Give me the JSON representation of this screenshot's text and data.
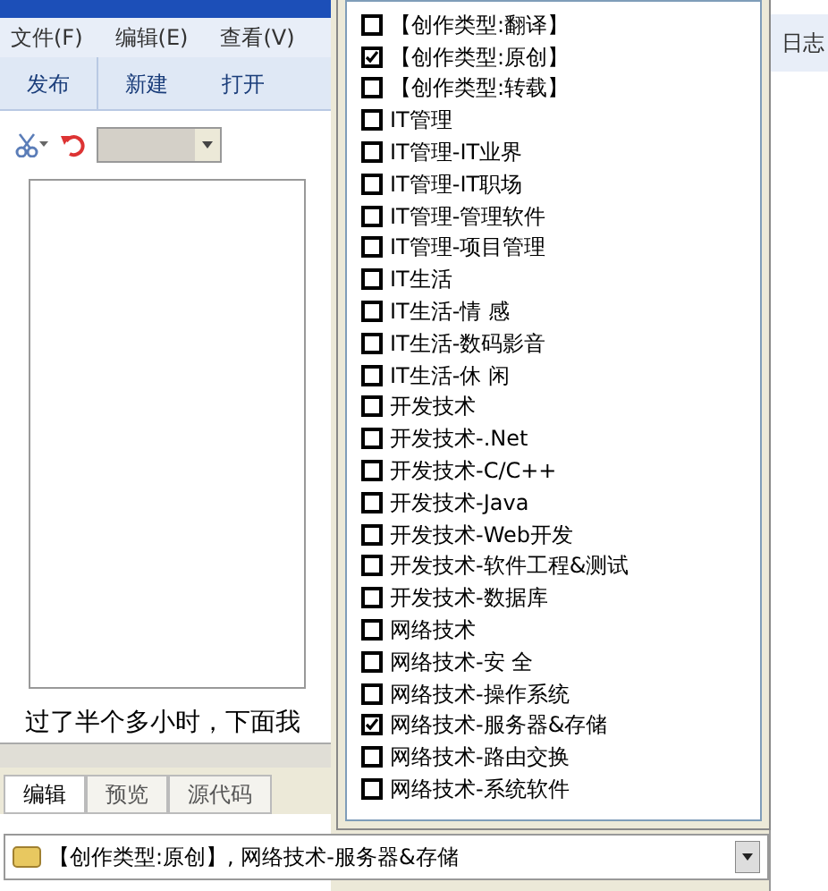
{
  "menu": [
    "文件(F)",
    "编辑(E)",
    "查看(V)"
  ],
  "right_menu": "日志",
  "toolbar": [
    "发布",
    "新建",
    "打开"
  ],
  "editor_text": "过了半个多小时，下面我",
  "tabs": [
    {
      "label": "编辑",
      "selected": true
    },
    {
      "label": "预览",
      "selected": false
    },
    {
      "label": "源代码",
      "selected": false
    }
  ],
  "category_field": {
    "value": "【创作类型:原创】, 网络技术-服务器&存储"
  },
  "categories": [
    {
      "label": "【创作类型:翻译】",
      "checked": false
    },
    {
      "label": "【创作类型:原创】",
      "checked": true
    },
    {
      "label": "【创作类型:转载】",
      "checked": false
    },
    {
      "label": "IT管理",
      "checked": false
    },
    {
      "label": "IT管理-IT业界",
      "checked": false
    },
    {
      "label": "IT管理-IT职场",
      "checked": false
    },
    {
      "label": "IT管理-管理软件",
      "checked": false
    },
    {
      "label": "IT管理-项目管理",
      "checked": false
    },
    {
      "label": "IT生活",
      "checked": false
    },
    {
      "label": "IT生活-情 感",
      "checked": false
    },
    {
      "label": "IT生活-数码影音",
      "checked": false
    },
    {
      "label": "IT生活-休 闲",
      "checked": false
    },
    {
      "label": "开发技术",
      "checked": false
    },
    {
      "label": "开发技术-.Net",
      "checked": false
    },
    {
      "label": "开发技术-C/C++",
      "checked": false
    },
    {
      "label": "开发技术-Java",
      "checked": false
    },
    {
      "label": "开发技术-Web开发",
      "checked": false
    },
    {
      "label": "开发技术-软件工程&测试",
      "checked": false
    },
    {
      "label": "开发技术-数据库",
      "checked": false
    },
    {
      "label": "网络技术",
      "checked": false
    },
    {
      "label": "网络技术-安 全",
      "checked": false
    },
    {
      "label": "网络技术-操作系统",
      "checked": false
    },
    {
      "label": "网络技术-服务器&存储",
      "checked": true
    },
    {
      "label": "网络技术-路由交换",
      "checked": false
    },
    {
      "label": "网络技术-系统软件",
      "checked": false
    }
  ]
}
